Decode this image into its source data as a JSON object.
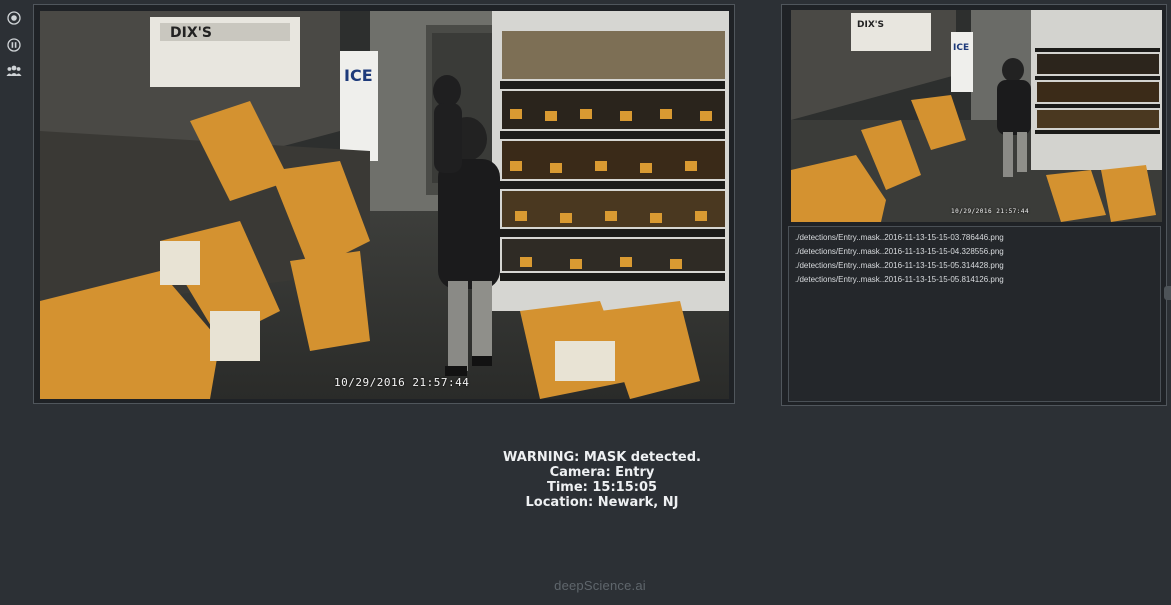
{
  "toolbar": {
    "icons": [
      "record-icon",
      "pause-icon",
      "users-icon"
    ]
  },
  "feeds": {
    "main": {
      "timestamp": "10/29/2016 21:57:44",
      "sign_text": "ICE",
      "store_sign": "DIX'S"
    },
    "secondary": {
      "timestamp": "10/29/2016 21:57:44",
      "sign_text": "ICE",
      "store_sign": "DIX'S"
    }
  },
  "detections": {
    "files": [
      "./detections/Entry..mask..2016-11-13-15-15-03.786446.png",
      "./detections/Entry..mask..2016-11-13-15-15-04.328556.png",
      "./detections/Entry..mask..2016-11-13-15-15-05.314428.png",
      "./detections/Entry..mask..2016-11-13-15-15-05.814126.png"
    ]
  },
  "alert": {
    "warning": "WARNING: MASK detected.",
    "camera": "Camera: Entry",
    "time": "Time: 15:15:05",
    "location": "Location: Newark, NJ"
  },
  "brand": {
    "name": "deepScience.ai"
  }
}
